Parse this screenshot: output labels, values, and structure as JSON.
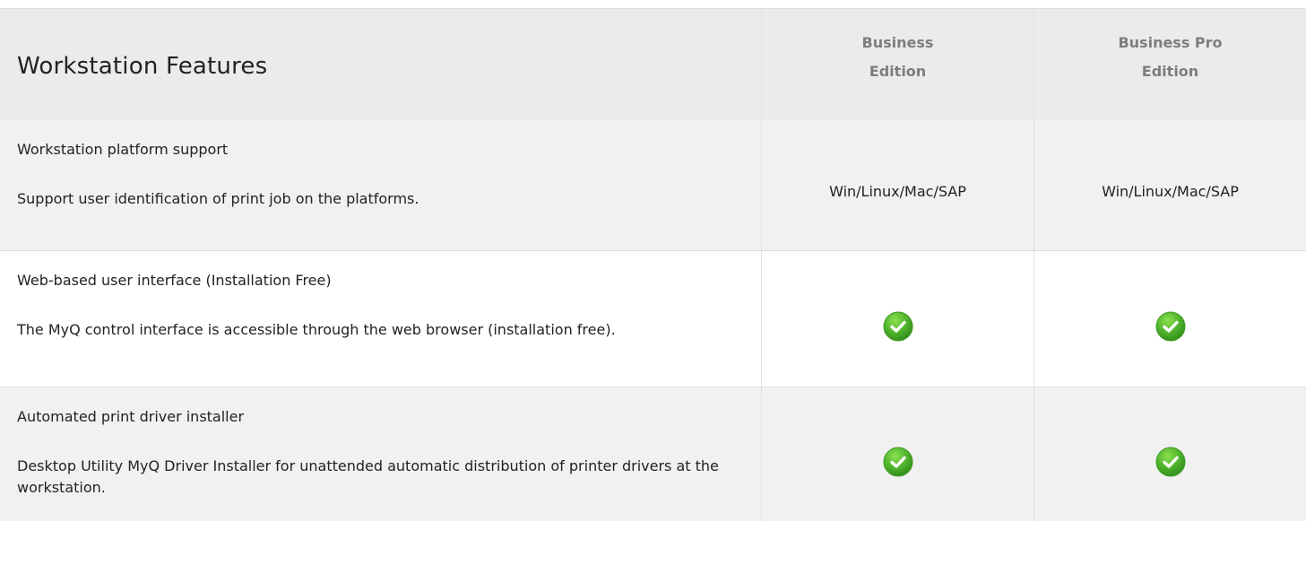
{
  "table": {
    "title": "Workstation Features",
    "columns": [
      {
        "line1": "Business",
        "line2": "Edition"
      },
      {
        "line1": "Business Pro",
        "line2": "Edition"
      }
    ],
    "rows": [
      {
        "name": "Workstation platform support",
        "description": "Support user identification of print job on the platforms.",
        "values": [
          "Win/Linux/Mac/SAP",
          "Win/Linux/Mac/SAP"
        ]
      },
      {
        "name": "Web-based user interface (Installation Free)",
        "description": "The MyQ control interface is accessible through the web browser (installation free).",
        "values": [
          "check",
          "check"
        ]
      },
      {
        "name": "Automated print driver installer",
        "description": "Desktop Utility MyQ Driver Installer for unattended automatic distribution of printer drivers at the workstation.",
        "values": [
          "check",
          "check"
        ]
      }
    ]
  },
  "colors": {
    "header_bg": "#ebebeb",
    "alt_row_bg": "#f1f1f1",
    "edition_text": "#7d7d7d",
    "check_green": "#4aa52a"
  },
  "icons": {
    "included": "green-check-circle-icon"
  }
}
